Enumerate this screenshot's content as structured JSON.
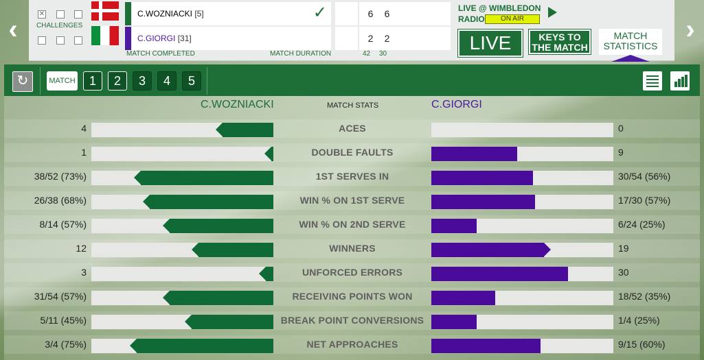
{
  "nav": {
    "prev": "‹",
    "next": "›"
  },
  "challenges_label": "CHALLENGES",
  "players": [
    {
      "name": "C.WOZNIACKI",
      "seed": "[5]",
      "color": "#1e6e38",
      "sets": [
        "6",
        "6"
      ],
      "winner": true
    },
    {
      "name": "C.GIORGI",
      "seed": "[31]",
      "color": "#4a1aa0",
      "sets": [
        "2",
        "2"
      ],
      "winner": false
    }
  ],
  "footer": {
    "status": "MATCH COMPLETED",
    "duration_label": "MATCH DURATION",
    "set_durations": [
      "42",
      "30"
    ]
  },
  "radio": {
    "title_line1": "LIVE @ WIMBLEDON",
    "title_line2": "RADIO",
    "badge": "ON AIR"
  },
  "buttons": {
    "live": "LIVE",
    "keys": "KEYS TO THE MATCH",
    "stats": "MATCH STATISTICS"
  },
  "toolbar": {
    "refresh": "↻",
    "tabs": [
      "MATCH",
      "1",
      "2",
      "3",
      "4",
      "5"
    ]
  },
  "headers": {
    "p1": "C.WOZNIACKI",
    "mid": "MATCH STATS",
    "p2": "C.GIORGI"
  },
  "stats": [
    {
      "label": "ACES",
      "p1": "4",
      "p2": "0",
      "p1_frac": 0.28,
      "p2_frac": 0.0
    },
    {
      "label": "DOUBLE FAULTS",
      "p1": "1",
      "p2": "9",
      "p1_frac": 0.01,
      "p2_frac": 0.47
    },
    {
      "label": "1ST SERVES IN",
      "p1": "38/52 (73%)",
      "p2": "30/54 (56%)",
      "p1_frac": 0.73,
      "p2_frac": 0.56
    },
    {
      "label": "WIN % ON 1ST SERVE",
      "p1": "26/38 (68%)",
      "p2": "17/30 (57%)",
      "p1_frac": 0.68,
      "p2_frac": 0.57
    },
    {
      "label": "WIN % ON 2ND SERVE",
      "p1": "8/14 (57%)",
      "p2": "6/24 (25%)",
      "p1_frac": 0.57,
      "p2_frac": 0.25
    },
    {
      "label": "WINNERS",
      "p1": "12",
      "p2": "19",
      "p1_frac": 0.41,
      "p2_frac": 0.62
    },
    {
      "label": "UNFORCED ERRORS",
      "p1": "3",
      "p2": "30",
      "p1_frac": 0.04,
      "p2_frac": 0.75
    },
    {
      "label": "RECEIVING POINTS WON",
      "p1": "31/54 (57%)",
      "p2": "18/52 (35%)",
      "p1_frac": 0.57,
      "p2_frac": 0.35
    },
    {
      "label": "BREAK POINT CONVERSIONS",
      "p1": "5/11 (45%)",
      "p2": "1/4 (25%)",
      "p1_frac": 0.45,
      "p2_frac": 0.25
    },
    {
      "label": "NET APPROACHES",
      "p1": "3/4 (75%)",
      "p2": "9/15 (60%)",
      "p1_frac": 0.75,
      "p2_frac": 0.6
    }
  ]
}
